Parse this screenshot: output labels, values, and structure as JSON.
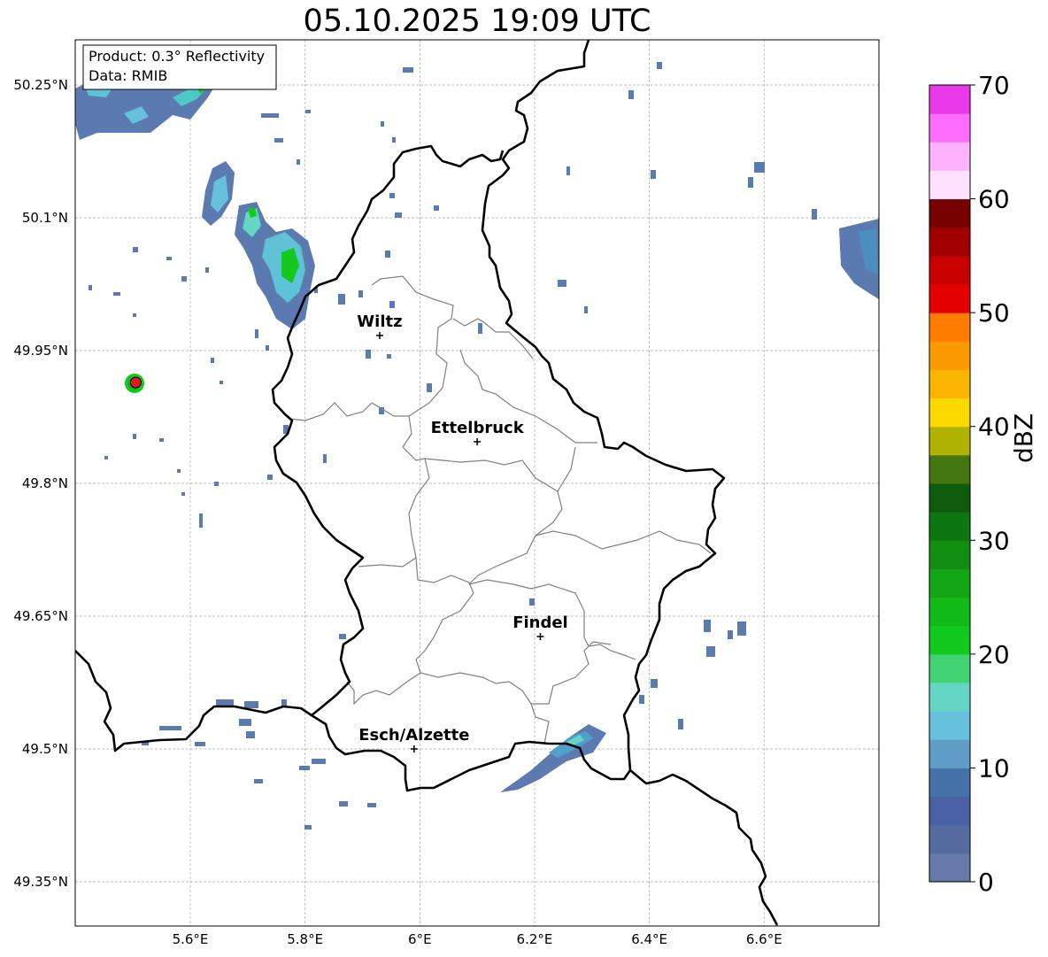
{
  "title": "05.10.2025 19:09 UTC",
  "info_box": {
    "product": "Product: 0.3° Reflectivity",
    "data": "Data: RMIB"
  },
  "map": {
    "lon_ticks": [
      "5.6°E",
      "5.8°E",
      "6°E",
      "6.2°E",
      "6.4°E",
      "6.6°E"
    ],
    "lat_ticks": [
      "50.25°N",
      "50.1°N",
      "49.95°N",
      "49.8°N",
      "49.65°N",
      "49.5°N",
      "49.35°N"
    ],
    "cities": [
      {
        "name": "Wiltz",
        "lon": 5.93,
        "lat": 49.967
      },
      {
        "name": "Ettelbruck",
        "lon": 6.1,
        "lat": 49.847
      },
      {
        "name": "Findel",
        "lon": 6.21,
        "lat": 49.627
      },
      {
        "name": "Esch/Alzette",
        "lon": 5.99,
        "lat": 49.5
      }
    ],
    "radar_site": {
      "lon": 5.505,
      "lat": 49.914
    }
  },
  "colorbar": {
    "label": "dBZ",
    "min": 0,
    "max": 70,
    "step": 2.5,
    "tick_values": [
      0,
      10,
      20,
      30,
      40,
      50,
      60,
      70
    ],
    "tick_labels": [
      "0",
      "10",
      "20",
      "30",
      "40",
      "50",
      "60",
      "70"
    ],
    "colors": [
      "#6779a8",
      "#556a9f",
      "#4a62a3",
      "#4472a8",
      "#5f9cc6",
      "#67c0dc",
      "#66d6c4",
      "#42d474",
      "#14c91e",
      "#12ba18",
      "#12a614",
      "#118e12",
      "#0e760e",
      "#0c5c0c",
      "#447711",
      "#b0b204",
      "#fbd800",
      "#fbb500",
      "#fb9a00",
      "#ff7c00",
      "#e30000",
      "#c70000",
      "#a00000",
      "#780000",
      "#ffe2ff",
      "#ffb3ff",
      "#ff6dff",
      "#e838e8"
    ]
  }
}
